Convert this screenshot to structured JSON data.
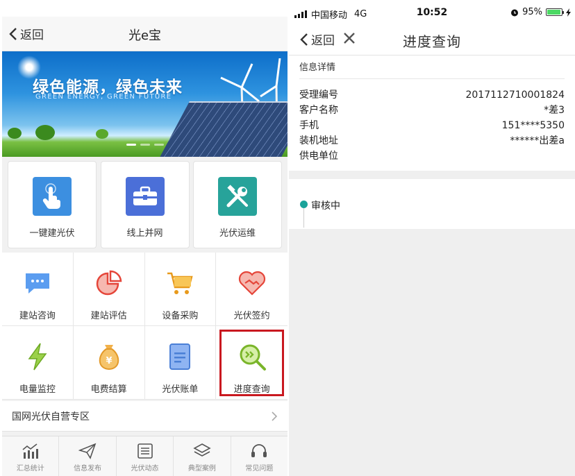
{
  "left": {
    "nav": {
      "back_label": "返回",
      "title": "光e宝"
    },
    "banner": {
      "slogan": "绿色能源，绿色未来",
      "subtitle": "GREEN ENERGY, GREEN FUTURE"
    },
    "big_tiles": [
      {
        "label": "一键建光伏",
        "icon": "hand-pointer-icon",
        "color": "#3c8fe0"
      },
      {
        "label": "线上并网",
        "icon": "toolbox-icon",
        "color": "#4b6fd8"
      },
      {
        "label": "光伏运维",
        "icon": "tools-icon",
        "color": "#27a39a"
      }
    ],
    "grid": [
      {
        "label": "建站咨询",
        "icon": "chat-bubble-icon"
      },
      {
        "label": "建站评估",
        "icon": "pie-chart-icon"
      },
      {
        "label": "设备采购",
        "icon": "cart-icon"
      },
      {
        "label": "光伏签约",
        "icon": "handshake-icon"
      },
      {
        "label": "电量监控",
        "icon": "lightning-icon"
      },
      {
        "label": "电费结算",
        "icon": "money-bag-icon"
      },
      {
        "label": "光伏账单",
        "icon": "bill-icon"
      },
      {
        "label": "进度查询",
        "icon": "progress-search-icon",
        "highlighted": true
      }
    ],
    "zone": {
      "label": "国网光伏自营专区"
    },
    "tabs": [
      {
        "label": "汇总统计",
        "icon": "stats-icon"
      },
      {
        "label": "信息发布",
        "icon": "paper-plane-icon"
      },
      {
        "label": "光伏动态",
        "icon": "list-icon"
      },
      {
        "label": "典型案例",
        "icon": "layers-icon"
      },
      {
        "label": "常见问题",
        "icon": "headset-icon"
      }
    ]
  },
  "right": {
    "status_bar": {
      "carrier": "中国移动",
      "network": "4G",
      "time": "10:52",
      "battery": "95%",
      "battery_level": 0.95
    },
    "nav": {
      "back_label": "返回",
      "title": "进度查询"
    },
    "section_title": "信息详情",
    "rows": [
      {
        "label": "受理编号",
        "value": "2017112710001824"
      },
      {
        "label": "客户名称",
        "value": "*差3"
      },
      {
        "label": "手机",
        "value": "151****5350"
      },
      {
        "label": "装机地址",
        "value": "******出差a"
      },
      {
        "label": "供电单位",
        "value": ""
      }
    ],
    "status_step": "审核中",
    "accent": "#1aa39a"
  }
}
